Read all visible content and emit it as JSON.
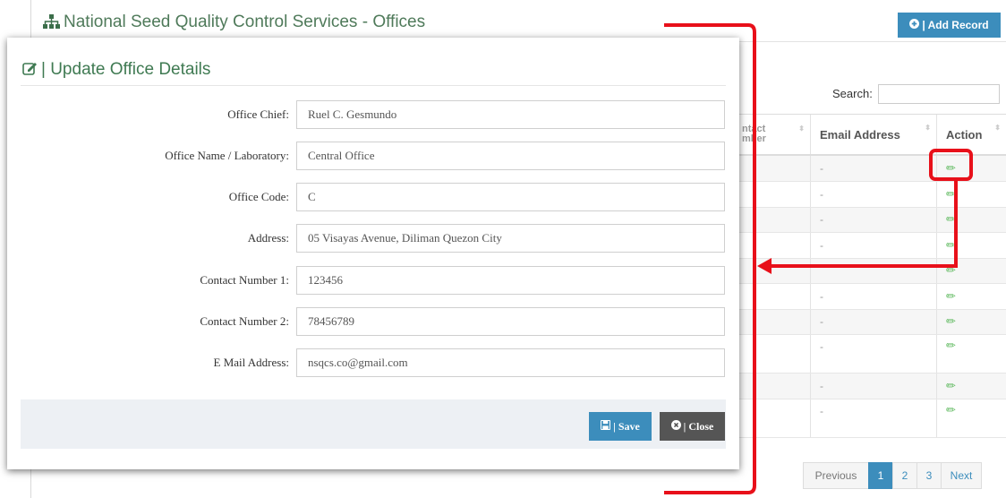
{
  "page": {
    "title": "National Seed Quality Control Services - Offices",
    "add_button_icon": "circle-plus-icon",
    "add_button_label": "| Add Record",
    "search_label": "Search:",
    "search_value": ""
  },
  "table": {
    "headers": {
      "contact": "ntact\nmber",
      "email": "Email Address",
      "action": "Action"
    },
    "rows": [
      {
        "email": "-"
      },
      {
        "email": "-"
      },
      {
        "email": "-"
      },
      {
        "email": "-"
      },
      {
        "email": ""
      },
      {
        "email": "-"
      },
      {
        "email": "-"
      },
      {
        "email": "-"
      },
      {
        "email": "-"
      },
      {
        "email": "-"
      }
    ]
  },
  "pagination": {
    "previous": "Previous",
    "pages": [
      "1",
      "2",
      "3"
    ],
    "active": "1",
    "next": "Next"
  },
  "modal": {
    "title_icon": "edit-icon",
    "title": "| Update Office Details",
    "fields": [
      {
        "label": "Office Chief:",
        "value": "Ruel C. Gesmundo"
      },
      {
        "label": "Office Name / Laboratory:",
        "value": "Central Office"
      },
      {
        "label": "Office Code:",
        "value": "C"
      },
      {
        "label": "Address:",
        "value": "05 Visayas Avenue, Diliman Quezon City"
      },
      {
        "label": "Contact Number 1:",
        "value": "123456"
      },
      {
        "label": "Contact Number 2:",
        "value": "78456789"
      },
      {
        "label": "E Mail Address:",
        "value": "nsqcs.co@gmail.com"
      }
    ],
    "save_label": "| Save",
    "save_icon": "floppy-icon",
    "close_label": "| Close",
    "close_icon": "circle-x-icon"
  },
  "colors": {
    "annotation": "#e8101a",
    "primary": "#3c8dbc",
    "title_green": "#3f7a52"
  }
}
